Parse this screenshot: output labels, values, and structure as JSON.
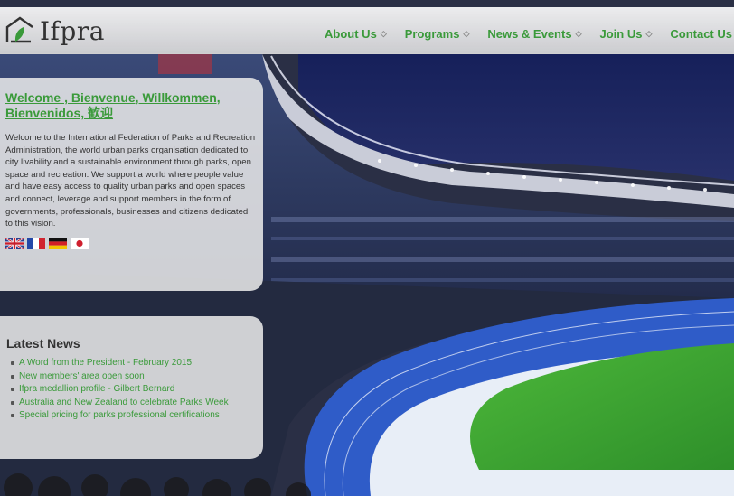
{
  "logo": {
    "text": "Ifpra"
  },
  "nav": {
    "items": [
      {
        "label": "About Us"
      },
      {
        "label": "Programs"
      },
      {
        "label": "News & Events"
      },
      {
        "label": "Join Us"
      },
      {
        "label": "Contact Us"
      }
    ]
  },
  "welcome": {
    "title": "Welcome , Bienvenue, Willkommen, Bienvenidos, 歓迎",
    "body": "Welcome to the International Federation of Parks and Recreation Administration, the world urban parks organisation dedicated to city livability and a sustainable environment through parks, open space and recreation. We support a world where people value and have easy access to quality urban parks and open spaces and connect, leverage and support members in the form of governments, professionals, businesses and citizens dedicated to this vision.",
    "flags": [
      {
        "icon": "uk-flag-icon"
      },
      {
        "icon": "france-flag-icon"
      },
      {
        "icon": "germany-flag-icon"
      },
      {
        "icon": "japan-flag-icon"
      }
    ]
  },
  "news": {
    "title": "Latest News",
    "items": [
      "A Word from the President - February 2015",
      "New members' area open soon",
      "Ifpra medallion profile - Gilbert Bernard",
      "Australia and New Zealand to celebrate Parks Week",
      "Special pricing for parks professional certifications"
    ]
  },
  "colors": {
    "link_green": "#3a9a3a",
    "text_dark": "#333333"
  }
}
